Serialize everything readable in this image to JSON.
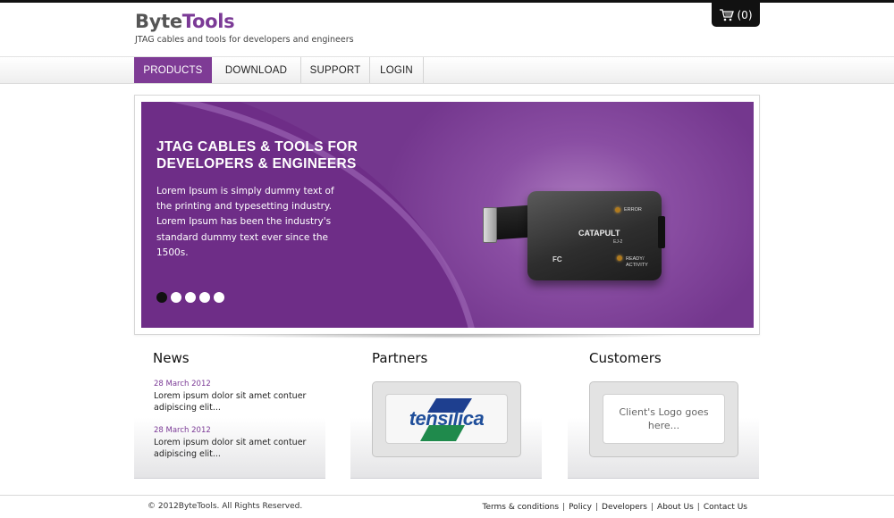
{
  "header": {
    "logo_part1": "Byte",
    "logo_part2": "Tools",
    "tagline": "JTAG cables and tools for developers and engineers",
    "cart_count": "(0)"
  },
  "nav": {
    "items": [
      {
        "label": "PRODUCTS",
        "active": true
      },
      {
        "label": "DOWNLOAD",
        "active": false
      },
      {
        "label": "SUPPORT",
        "active": false
      },
      {
        "label": "LOGIN",
        "active": false
      }
    ]
  },
  "banner": {
    "title_line1": "JTAG CABLES & TOOLS FOR",
    "title_line2": "DEVELOPERS & ENGINEERS",
    "text": "Lorem Ipsum is simply dummy text of the printing and typesetting industry. Lorem Ipsum has been the industry's standard dummy text ever since the 1500s.",
    "slide_count": 5,
    "active_slide": 1,
    "device": {
      "brand": "CATAPULT",
      "model": "EJ-2",
      "led1": "ERROR",
      "led2_line1": "READY/",
      "led2_line2": "ACTIVITY",
      "mark": "FC"
    }
  },
  "news": {
    "title": "News",
    "items": [
      {
        "date": "28 March 2012",
        "text": "Lorem ipsum dolor sit amet contuer adipiscing elit..."
      },
      {
        "date": "28 March 2012",
        "text": "Lorem ipsum dolor sit amet contuer adipiscing elit..."
      }
    ]
  },
  "partners": {
    "title": "Partners",
    "logo_text": "tensilica"
  },
  "customers": {
    "title": "Customers",
    "placeholder": "Client's Logo goes here..."
  },
  "footer": {
    "copyright": "© 2012ByteTools. All Rights Reserved.",
    "links": [
      "Terms & conditions",
      "Policy",
      "Developers",
      "About Us",
      "Contact Us"
    ]
  },
  "colors": {
    "brand_purple": "#7e3b95",
    "dark": "#111111"
  }
}
